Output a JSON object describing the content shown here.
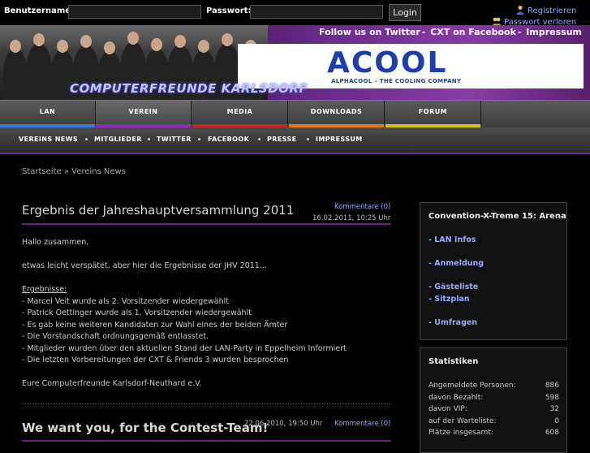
{
  "login": {
    "username_label": "Benutzername:",
    "password_label": "Passwort:",
    "login_button": "Login",
    "register_link": "Registrieren",
    "forgot_link": "Passwort verloren"
  },
  "header": {
    "social_links": [
      "Follow us on Twitter",
      "CXT on Facebook",
      "Impressum"
    ],
    "club_title": "COMPUTERFREUNDE KARLSDORF",
    "ad_logo": "ACOOL",
    "ad_tagline": "ALPHACOOL – THE COOLING COMPANY"
  },
  "main_nav": [
    {
      "label": "LAN",
      "color": "#3a7bd5"
    },
    {
      "label": "VEREIN",
      "color": "#8a2fb0"
    },
    {
      "label": "MEDIA",
      "color": "#c0282a"
    },
    {
      "label": "DOWNLOADS",
      "color": "#e07a1c"
    },
    {
      "label": "FORUM",
      "color": "#d6c21c"
    }
  ],
  "sub_nav": [
    "VEREINS NEWS",
    "MITGLIEDER",
    "TWITTER",
    "FACEBOOK",
    "PRESSE",
    "IMPRESSUM"
  ],
  "breadcrumb": {
    "home": "Startseite",
    "separator": "»",
    "current": "Vereins News"
  },
  "articles": [
    {
      "title": "Ergebnis der Jahreshauptversammlung 2011",
      "comments": "Kommentare (0)",
      "date": "16.02.2011, 10:25 Uhr",
      "body": [
        "Hallo zusammen,",
        "",
        "etwas leicht verspätet, aber hier die Ergebnisse der JHV 2011...",
        "",
        "Ergebnisse:",
        "- Marcel Veit wurde als 2. Vorsitzender wiedergewählt",
        "- Patrick Oettinger wurde als 1. Vorsitzender wiedergewählt",
        "- Es gab keine weiteren Kandidaten zur Wahl eines der beiden Ämter",
        "- Die Vorstandschaft ordnungsgemäß entlasstet.",
        "- Mitglieder wurden über den aktuellen Stand der LAN-Party in Eppelheim Informiert",
        "- Die letzten Vorbereitungen der CXT & Friends 3 wurden besprochen",
        "",
        "Eure Computerfreunde Karlsdorf-Neuthard e.V."
      ]
    },
    {
      "title": "We want you, for the Contest-Team!",
      "comments": "Kommentare (0)",
      "date": "22.06.2010, 19:50 Uhr"
    }
  ],
  "sidebar": {
    "event_box": {
      "title": "Convention-X-Treme 15: Arena",
      "links": [
        "- LAN Infos",
        "- Anmeldung",
        "- Gästeliste",
        "- Sitzplan",
        "- Umfragen"
      ]
    },
    "stats_box": {
      "title": "Statistiken",
      "rows": [
        {
          "label": "Angemeldete Personen:",
          "value": "886"
        },
        {
          "label": "davon Bezahlt:",
          "value": "598"
        },
        {
          "label": "davon VIP:",
          "value": "32"
        },
        {
          "label": "auf der Warteliste:",
          "value": "0"
        },
        {
          "label": "Plätze insgesamt:",
          "value": "608"
        }
      ]
    }
  }
}
